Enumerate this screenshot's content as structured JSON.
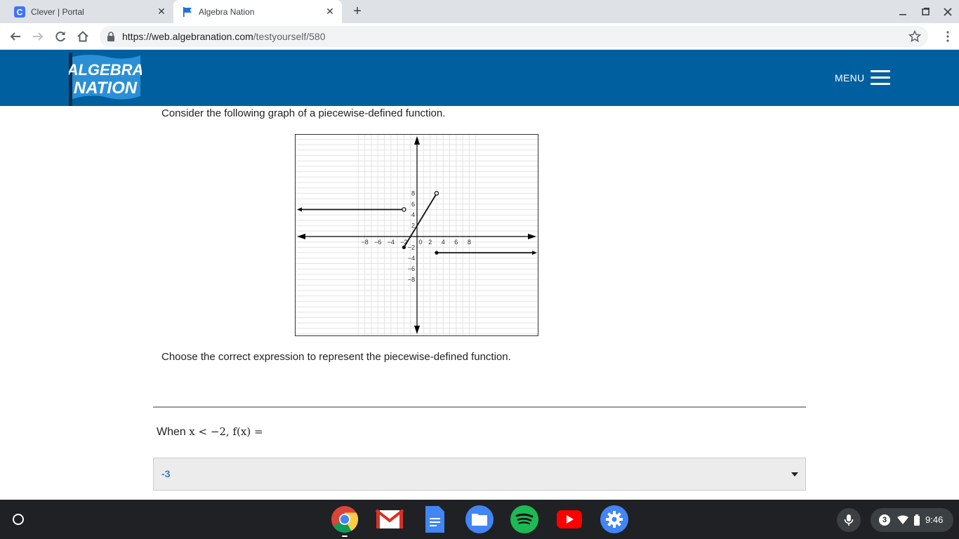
{
  "browser": {
    "tabs": [
      {
        "title": "Clever | Portal",
        "icon": "clever-c-icon",
        "active": false
      },
      {
        "title": "Algebra Nation",
        "icon": "blue-flag-icon",
        "active": true
      }
    ],
    "url_host": "https://web.algebranation.com",
    "url_path": "/testyourself/580"
  },
  "site": {
    "logo_line1": "ALGEBRA",
    "logo_line2": "NATION",
    "menu_label": "MENU",
    "brand_color": "#005f9e"
  },
  "main": {
    "question": "Consider the following graph of a piecewise-defined function.",
    "prompt": "Choose the correct expression to represent the piecewise-defined function.",
    "when_label": "When",
    "condition": "x < −2, f(x) =",
    "dropdown_value": "-3"
  },
  "graph": {
    "x_ticks": [
      "−8",
      "−6",
      "−4",
      "−2",
      "0",
      "2",
      "4",
      "6",
      "8"
    ],
    "y_ticks": [
      "8",
      "6",
      "4",
      "2",
      "−2",
      "−4",
      "−6",
      "−8"
    ]
  },
  "shelf": {
    "apps": [
      "chrome-icon",
      "gmail-icon",
      "docs-icon",
      "files-icon",
      "spotify-icon",
      "youtube-icon",
      "settings-icon"
    ],
    "notification_count": "3",
    "time": "9:46"
  }
}
